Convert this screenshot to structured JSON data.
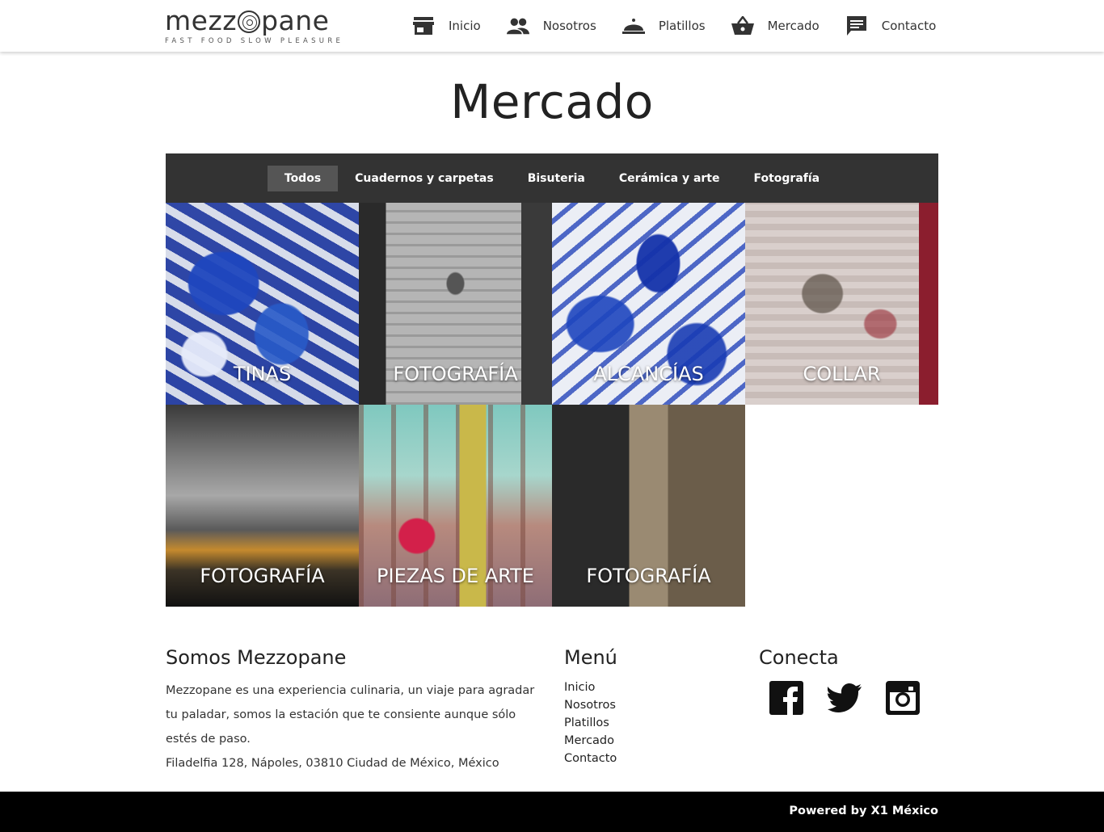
{
  "header": {
    "logo_text": "mezzopane",
    "logo_tagline": "FAST FOOD SLOW PLEASURE",
    "nav": [
      {
        "label": "Inicio",
        "icon": "store-icon"
      },
      {
        "label": "Nosotros",
        "icon": "people-icon"
      },
      {
        "label": "Platillos",
        "icon": "cloche-icon"
      },
      {
        "label": "Mercado",
        "icon": "basket-icon"
      },
      {
        "label": "Contacto",
        "icon": "chat-icon"
      }
    ]
  },
  "page": {
    "title": "Mercado"
  },
  "filters": {
    "items": [
      "Todos",
      "Cuadernos y carpetas",
      "Bisuteria",
      "Cerámica y arte",
      "Fotografía"
    ],
    "active": "Todos"
  },
  "products": [
    {
      "label": "TINAS"
    },
    {
      "label": "FOTOGRAFÍA"
    },
    {
      "label": "ALCANCÍAS"
    },
    {
      "label": "COLLAR"
    },
    {
      "label": "FOTOGRAFÍA"
    },
    {
      "label": "PIEZAS DE ARTE"
    },
    {
      "label": "FOTOGRAFÍA"
    }
  ],
  "footer": {
    "about": {
      "heading": "Somos Mezzopane",
      "text": "Mezzopane es una experiencia culinaria, un viaje para agradar tu paladar, somos la estación que te consiente aunque sólo estés de paso.",
      "address": "Filadelfia 128, Nápoles, 03810 Ciudad de México, México"
    },
    "menu": {
      "heading": "Menú",
      "items": [
        "Inicio",
        "Nosotros",
        "Platillos",
        "Mercado",
        "Contacto"
      ]
    },
    "connect": {
      "heading": "Conecta",
      "icons": [
        "facebook-icon",
        "twitter-icon",
        "instagram-icon"
      ]
    },
    "powered_by": "Powered by X1 México"
  },
  "colors": {
    "filter_bar": "#333333",
    "filter_active": "#555555",
    "bottom_bar": "#000000"
  }
}
